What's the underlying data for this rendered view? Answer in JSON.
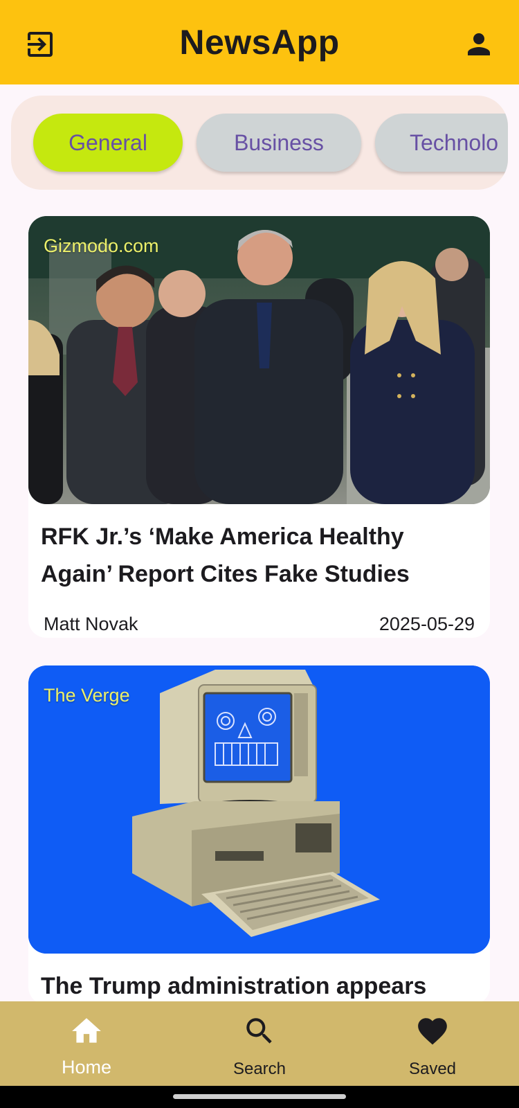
{
  "app": {
    "title": "NewsApp"
  },
  "header": {
    "logout_icon": "logout-icon",
    "profile_icon": "account-icon"
  },
  "categories": [
    {
      "label": "General",
      "selected": true
    },
    {
      "label": "Business",
      "selected": false
    },
    {
      "label": "Technolo",
      "selected": false
    }
  ],
  "articles": [
    {
      "source": "Gizmodo.com",
      "headline": "RFK Jr.’s ‘Make America Healthy Again’ Report Cites Fake Studies",
      "author": "Matt Novak",
      "date": "2025-05-29"
    },
    {
      "source": "The Verge",
      "headline": "The Trump administration appears",
      "author": "",
      "date": ""
    }
  ],
  "bottom_nav": [
    {
      "label": "Home",
      "icon": "home-icon",
      "selected": true
    },
    {
      "label": "Search",
      "icon": "search-icon",
      "selected": false
    },
    {
      "label": "Saved",
      "icon": "heart-icon",
      "selected": false
    }
  ],
  "colors": {
    "appbar": "#fdc20f",
    "chip_selected": "#c5e80f",
    "chip": "#cfd4d5",
    "chip_text": "#6750a4",
    "bottom_nav": "#d1b86c",
    "source_text": "#ecf06a",
    "verge_image_bg": "#0f5cf5"
  }
}
